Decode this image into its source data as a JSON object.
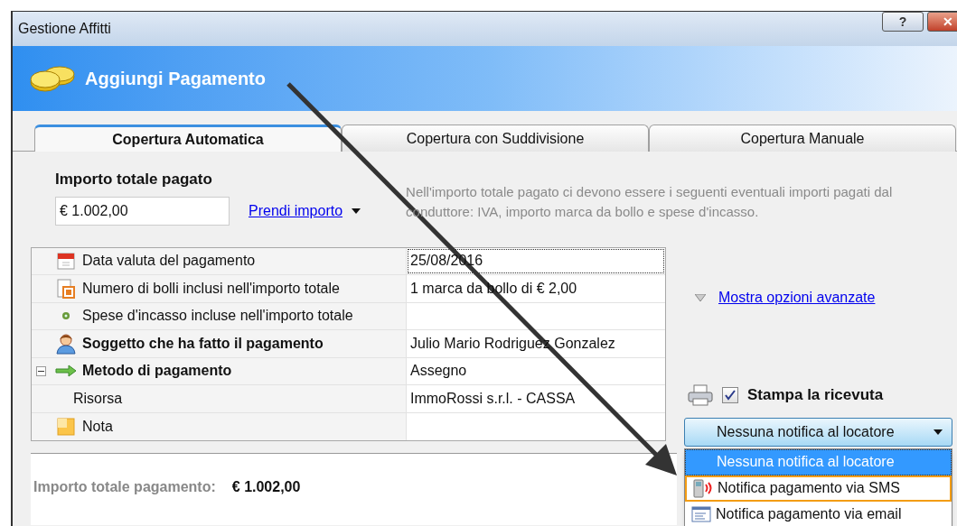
{
  "window": {
    "title": "Gestione Affitti",
    "buttons": [
      "?",
      "✕"
    ]
  },
  "header": {
    "title": "Aggiungi Pagamento"
  },
  "tabs": [
    {
      "label": "Copertura Automatica",
      "selected": true
    },
    {
      "label": "Copertura con Suddivisione",
      "selected": false
    },
    {
      "label": "Copertura Manuale",
      "selected": false
    }
  ],
  "amount": {
    "label": "Importo totale pagato",
    "value": "€ 1.002,00",
    "link": "Prendi importo",
    "hint": "Nell'importo totale pagato ci devono essere i seguenti eventuali importi pagati dal conduttore: IVA, importo marca da bollo e spese d'incasso."
  },
  "properties": [
    {
      "label": "Data valuta del pagamento",
      "value": "25/08/2016",
      "bold": false,
      "focused": true
    },
    {
      "label": "Numero di bolli inclusi nell'importo totale",
      "value": "1 marca da bollo di € 2,00",
      "bold": false,
      "focused": false
    },
    {
      "label": "Spese d'incasso incluse nell'importo totale",
      "bold": false,
      "focused": false
    },
    {
      "label": "Soggetto che ha fatto il pagamento",
      "value": "Julio Mario Rodriguez Gonzalez",
      "bold": true,
      "focused": false
    },
    {
      "label": "Metodo di pagamento",
      "value": "Assegno",
      "bold": true,
      "focused": false,
      "expanded": true,
      "children": [
        {
          "label": "Risorsa",
          "value": "ImmoRossi s.r.l. - CASSA",
          "bold": false,
          "focused": false
        }
      ]
    },
    {
      "label": "Nota",
      "bold": false,
      "focused": false
    }
  ],
  "advanced_link": "Mostra opzioni avanzate",
  "print_receipt": {
    "label": "Stampa la ricevuta",
    "checked": true
  },
  "notification": {
    "value": "Nessuna notifica al locatore",
    "options": [
      {
        "label": "Nessuna notifica al locatore",
        "selected": true,
        "highlighted": false
      },
      {
        "label": "Notifica pagamento via SMS",
        "selected": false,
        "highlighted": true
      },
      {
        "label": "Notifica pagamento via email",
        "selected": false,
        "highlighted": false
      }
    ]
  },
  "total": {
    "label": "Importo totale pagamento:",
    "value": "€ 1.002,00"
  }
}
